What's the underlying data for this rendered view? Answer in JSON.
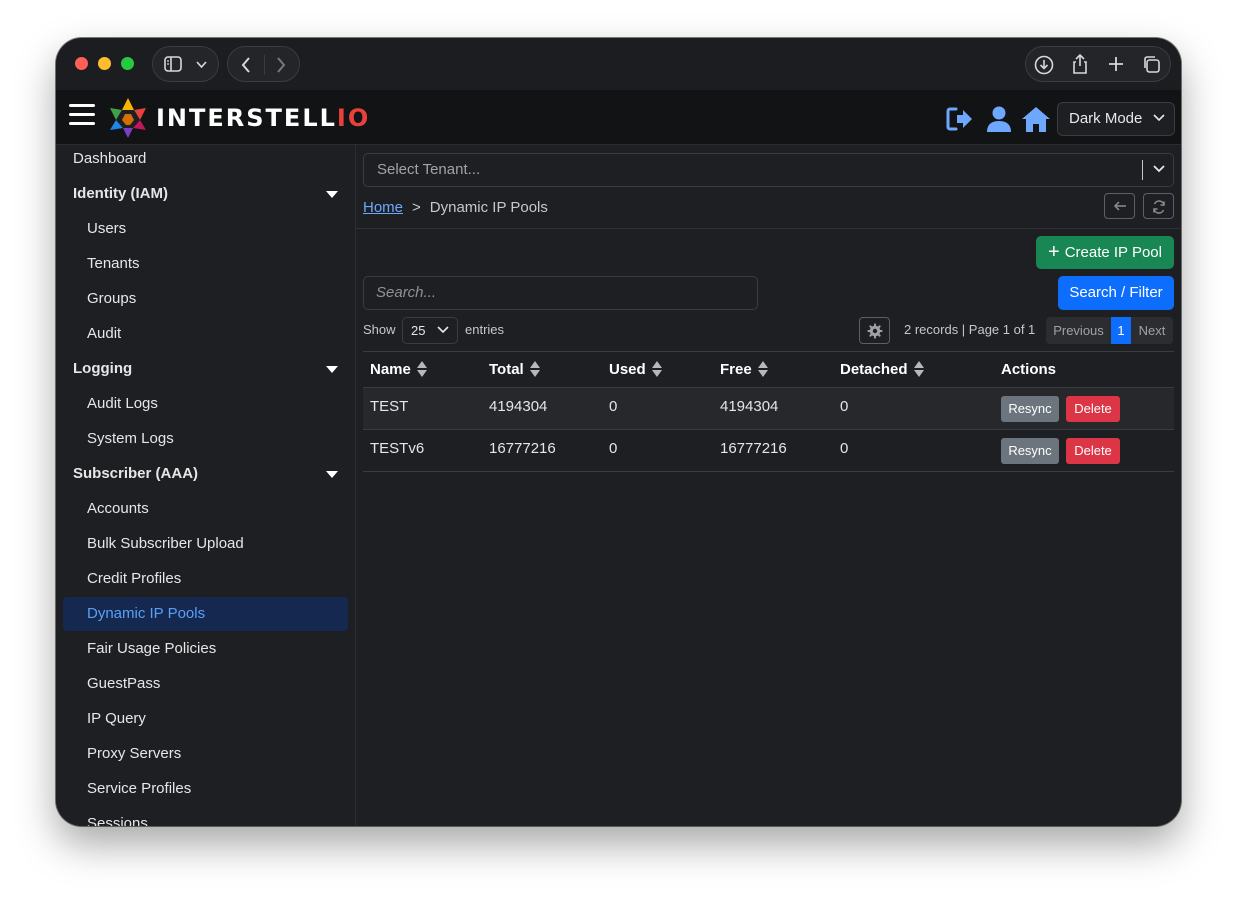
{
  "header": {
    "brand_main": "INTERSTELL",
    "brand_accent": "IO",
    "theme_select": "Dark Mode",
    "icons": [
      "sign-out-icon",
      "user-icon",
      "home-icon"
    ]
  },
  "sidebar": {
    "dashboard": "Dashboard",
    "sections": [
      {
        "label": "Identity (IAM)",
        "items": [
          "Users",
          "Tenants",
          "Groups",
          "Audit"
        ]
      },
      {
        "label": "Logging",
        "items": [
          "Audit Logs",
          "System Logs"
        ]
      },
      {
        "label": "Subscriber (AAA)",
        "items": [
          "Accounts",
          "Bulk Subscriber Upload",
          "Credit Profiles",
          "Dynamic IP Pools",
          "Fair Usage Policies",
          "GuestPass",
          "IP Query",
          "Proxy Servers",
          "Service Profiles",
          "Sessions"
        ]
      }
    ],
    "active_item": "Dynamic IP Pools"
  },
  "main": {
    "tenant_placeholder": "Select Tenant...",
    "breadcrumb": {
      "home": "Home",
      "separator": ">",
      "current": "Dynamic IP Pools"
    },
    "create_label": "Create IP Pool",
    "create_plus": "+",
    "search_placeholder": "Search...",
    "search_button": "Search / Filter",
    "show_label": "Show",
    "entries_value": "25",
    "entries_label": "entries",
    "records_info": "2 records | Page 1 of 1",
    "pager": {
      "previous": "Previous",
      "current": "1",
      "next": "Next"
    }
  },
  "table": {
    "columns": [
      "Name",
      "Total",
      "Used",
      "Free",
      "Detached",
      "Actions"
    ],
    "rows": [
      {
        "name": "TEST",
        "total": "4194304",
        "used": "0",
        "free": "4194304",
        "detached": "0",
        "resync": "Resync",
        "delete": "Delete"
      },
      {
        "name": "TESTv6",
        "total": "16777216",
        "used": "0",
        "free": "16777216",
        "detached": "0",
        "resync": "Resync",
        "delete": "Delete"
      }
    ]
  },
  "colors": {
    "accent_blue": "#0d6efd",
    "success_green": "#198754",
    "danger_red": "#dc3545",
    "secondary_gray": "#6c757d",
    "active_nav_bg": "#15284f"
  }
}
